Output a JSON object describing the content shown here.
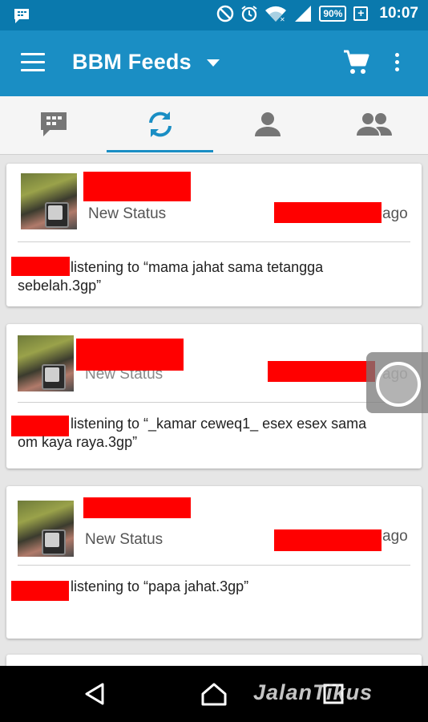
{
  "status_bar": {
    "battery": "90%",
    "time": "10:07",
    "icons": [
      "bbm-notification-icon",
      "do-not-disturb-icon",
      "alarm-icon",
      "wifi-icon",
      "signal-icon",
      "battery-icon"
    ]
  },
  "app_bar": {
    "title": "BBM Feeds",
    "icons": [
      "menu-icon",
      "dropdown-caret-icon",
      "shopping-cart-icon",
      "more-vert-icon"
    ]
  },
  "tabs": [
    {
      "name": "chats",
      "icon": "bbm-chat-icon",
      "active": false
    },
    {
      "name": "feeds",
      "icon": "refresh-icon",
      "active": true
    },
    {
      "name": "contacts",
      "icon": "person-icon",
      "active": false
    },
    {
      "name": "groups",
      "icon": "group-icon",
      "active": false
    }
  ],
  "feed": [
    {
      "status_label": "New Status",
      "time_suffix": "ago",
      "message": "listening to “mama jahat sama tetangga sebelah.3gp”"
    },
    {
      "status_label": "New Status",
      "time_suffix": "ago",
      "message": "listening to “_kamar ceweq1_ esex esex sama om kaya raya.3gp”"
    },
    {
      "status_label": "New Status",
      "time_suffix": "ago",
      "message": "listening to “papa jahat.3gp”"
    }
  ],
  "nav_bar": {
    "icons": [
      "back-icon",
      "home-icon",
      "recents-icon"
    ]
  },
  "watermark": "JalanTikus",
  "colors": {
    "status_bar": "#0a79ad",
    "app_bar": "#1a8ec4",
    "accent": "#1a8ec4",
    "redaction": "#ff0000"
  }
}
